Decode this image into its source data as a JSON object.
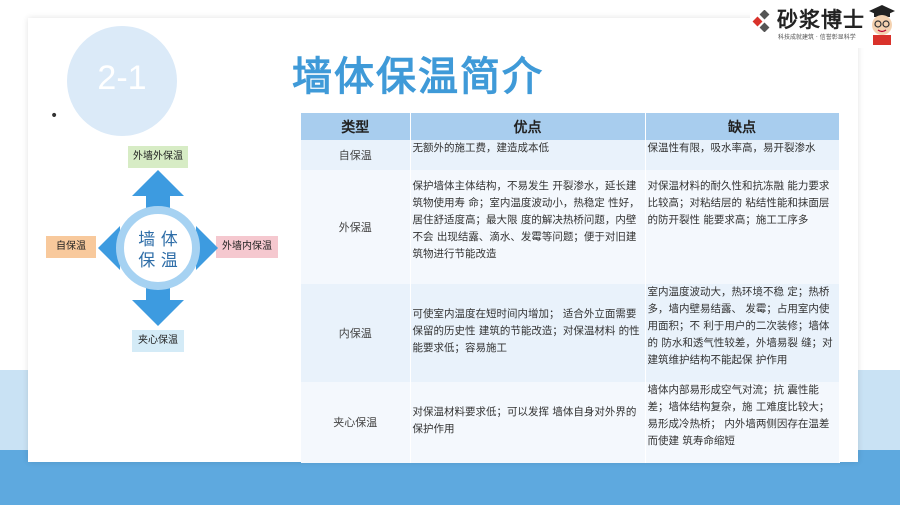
{
  "slide": {
    "section_number": "2-1",
    "title": "墙体保温简介",
    "bullet": "•"
  },
  "logo": {
    "brand_name": "砂浆博士",
    "tagline": "科技成就建筑 · 信誉彰显科学"
  },
  "diagram": {
    "center_text": "墙体保温",
    "top_label": "外墙外保温",
    "left_label": "自保温",
    "right_label": "外墙内保温",
    "bottom_label": "夹心保温",
    "arrow_color": "#3d9be0",
    "ring_color": "#a6d2f2"
  },
  "table": {
    "headers": [
      "类型",
      "优点",
      "缺点"
    ],
    "rows": [
      {
        "type": "自保温",
        "pros": "无额外的施工费，建造成本低",
        "cons": "保温性有限，吸水率高，易开裂渗水"
      },
      {
        "type": "外保温",
        "pros": "保护墙体主体结构，不易发生 开裂渗水，延长建筑物使用寿 命；室内温度波动小，热稳定 性好，居住舒适度高；最大限 度的解决热桥问题，内壁不会 出现结露、滴水、发霉等问题；便于对旧建筑物进行节能改造",
        "cons": "对保温材料的耐久性和抗冻融 能力要求比较高；对粘结层的 粘结性能和抹面层的防开裂性 能要求高；施工工序多"
      },
      {
        "type": "内保温",
        "pros": "可使室内温度在短时间内增加； 适合外立面需要保留的历史性 建筑的节能改造；对保温材料 的性能要求低；容易施工",
        "cons": "室内温度波动大，热环境不稳 定；热桥多，墙内壁易结露、 发霉；占用室内使用面积；不 利于用户的二次装修；墙体的 防水和透气性较差，外墙易裂 缝；对建筑维护结构不能起保 护作用"
      },
      {
        "type": "夹心保温",
        "pros": "对保温材料要求低；可以发挥 墙体自身对外界的保护作用",
        "cons": "墙体内部易形成空气对流；抗 震性能差；墙体结构复杂，施 工难度比较大；易形成冷热桥； 内外墙两侧因存在温差而使建 筑寿命缩短"
      }
    ]
  }
}
